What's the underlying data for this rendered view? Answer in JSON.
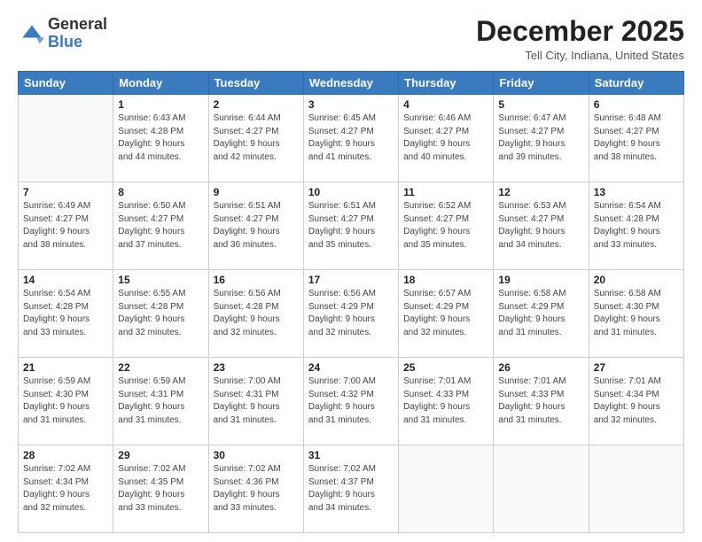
{
  "header": {
    "logo_general": "General",
    "logo_blue": "Blue",
    "month_title": "December 2025",
    "location": "Tell City, Indiana, United States"
  },
  "weekdays": [
    "Sunday",
    "Monday",
    "Tuesday",
    "Wednesday",
    "Thursday",
    "Friday",
    "Saturday"
  ],
  "weeks": [
    [
      {
        "day": "",
        "info": ""
      },
      {
        "day": "1",
        "info": "Sunrise: 6:43 AM\nSunset: 4:28 PM\nDaylight: 9 hours\nand 44 minutes."
      },
      {
        "day": "2",
        "info": "Sunrise: 6:44 AM\nSunset: 4:27 PM\nDaylight: 9 hours\nand 42 minutes."
      },
      {
        "day": "3",
        "info": "Sunrise: 6:45 AM\nSunset: 4:27 PM\nDaylight: 9 hours\nand 41 minutes."
      },
      {
        "day": "4",
        "info": "Sunrise: 6:46 AM\nSunset: 4:27 PM\nDaylight: 9 hours\nand 40 minutes."
      },
      {
        "day": "5",
        "info": "Sunrise: 6:47 AM\nSunset: 4:27 PM\nDaylight: 9 hours\nand 39 minutes."
      },
      {
        "day": "6",
        "info": "Sunrise: 6:48 AM\nSunset: 4:27 PM\nDaylight: 9 hours\nand 38 minutes."
      }
    ],
    [
      {
        "day": "7",
        "info": "Sunrise: 6:49 AM\nSunset: 4:27 PM\nDaylight: 9 hours\nand 38 minutes."
      },
      {
        "day": "8",
        "info": "Sunrise: 6:50 AM\nSunset: 4:27 PM\nDaylight: 9 hours\nand 37 minutes."
      },
      {
        "day": "9",
        "info": "Sunrise: 6:51 AM\nSunset: 4:27 PM\nDaylight: 9 hours\nand 36 minutes."
      },
      {
        "day": "10",
        "info": "Sunrise: 6:51 AM\nSunset: 4:27 PM\nDaylight: 9 hours\nand 35 minutes."
      },
      {
        "day": "11",
        "info": "Sunrise: 6:52 AM\nSunset: 4:27 PM\nDaylight: 9 hours\nand 35 minutes."
      },
      {
        "day": "12",
        "info": "Sunrise: 6:53 AM\nSunset: 4:27 PM\nDaylight: 9 hours\nand 34 minutes."
      },
      {
        "day": "13",
        "info": "Sunrise: 6:54 AM\nSunset: 4:28 PM\nDaylight: 9 hours\nand 33 minutes."
      }
    ],
    [
      {
        "day": "14",
        "info": "Sunrise: 6:54 AM\nSunset: 4:28 PM\nDaylight: 9 hours\nand 33 minutes."
      },
      {
        "day": "15",
        "info": "Sunrise: 6:55 AM\nSunset: 4:28 PM\nDaylight: 9 hours\nand 32 minutes."
      },
      {
        "day": "16",
        "info": "Sunrise: 6:56 AM\nSunset: 4:28 PM\nDaylight: 9 hours\nand 32 minutes."
      },
      {
        "day": "17",
        "info": "Sunrise: 6:56 AM\nSunset: 4:29 PM\nDaylight: 9 hours\nand 32 minutes."
      },
      {
        "day": "18",
        "info": "Sunrise: 6:57 AM\nSunset: 4:29 PM\nDaylight: 9 hours\nand 32 minutes."
      },
      {
        "day": "19",
        "info": "Sunrise: 6:58 AM\nSunset: 4:29 PM\nDaylight: 9 hours\nand 31 minutes."
      },
      {
        "day": "20",
        "info": "Sunrise: 6:58 AM\nSunset: 4:30 PM\nDaylight: 9 hours\nand 31 minutes."
      }
    ],
    [
      {
        "day": "21",
        "info": "Sunrise: 6:59 AM\nSunset: 4:30 PM\nDaylight: 9 hours\nand 31 minutes."
      },
      {
        "day": "22",
        "info": "Sunrise: 6:59 AM\nSunset: 4:31 PM\nDaylight: 9 hours\nand 31 minutes."
      },
      {
        "day": "23",
        "info": "Sunrise: 7:00 AM\nSunset: 4:31 PM\nDaylight: 9 hours\nand 31 minutes."
      },
      {
        "day": "24",
        "info": "Sunrise: 7:00 AM\nSunset: 4:32 PM\nDaylight: 9 hours\nand 31 minutes."
      },
      {
        "day": "25",
        "info": "Sunrise: 7:01 AM\nSunset: 4:33 PM\nDaylight: 9 hours\nand 31 minutes."
      },
      {
        "day": "26",
        "info": "Sunrise: 7:01 AM\nSunset: 4:33 PM\nDaylight: 9 hours\nand 31 minutes."
      },
      {
        "day": "27",
        "info": "Sunrise: 7:01 AM\nSunset: 4:34 PM\nDaylight: 9 hours\nand 32 minutes."
      }
    ],
    [
      {
        "day": "28",
        "info": "Sunrise: 7:02 AM\nSunset: 4:34 PM\nDaylight: 9 hours\nand 32 minutes."
      },
      {
        "day": "29",
        "info": "Sunrise: 7:02 AM\nSunset: 4:35 PM\nDaylight: 9 hours\nand 33 minutes."
      },
      {
        "day": "30",
        "info": "Sunrise: 7:02 AM\nSunset: 4:36 PM\nDaylight: 9 hours\nand 33 minutes."
      },
      {
        "day": "31",
        "info": "Sunrise: 7:02 AM\nSunset: 4:37 PM\nDaylight: 9 hours\nand 34 minutes."
      },
      {
        "day": "",
        "info": ""
      },
      {
        "day": "",
        "info": ""
      },
      {
        "day": "",
        "info": ""
      }
    ]
  ]
}
